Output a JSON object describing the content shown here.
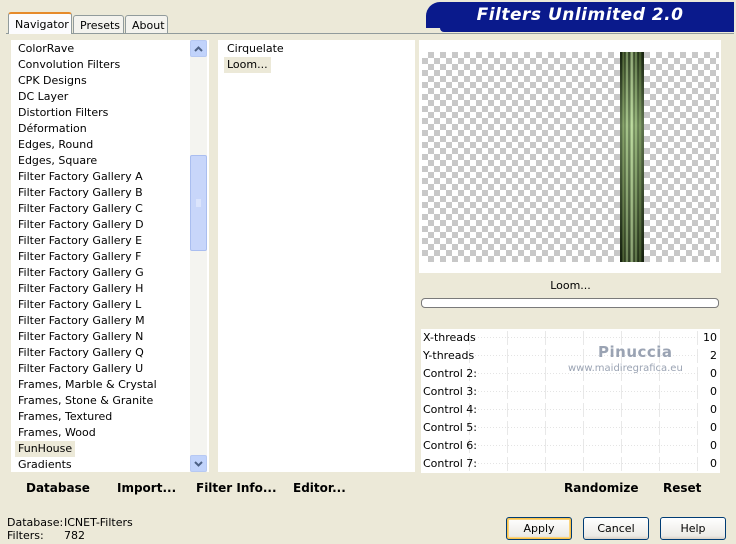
{
  "title": "Filters Unlimited 2.0",
  "tabs": [
    {
      "label": "Navigator",
      "active": true
    },
    {
      "label": "Presets",
      "active": false
    },
    {
      "label": "About",
      "active": false
    }
  ],
  "categories": {
    "items": [
      "ColorRave",
      "Convolution Filters",
      "CPK Designs",
      "DC Layer",
      "Distortion Filters",
      "Déformation",
      "Edges, Round",
      "Edges, Square",
      "Filter Factory Gallery A",
      "Filter Factory Gallery B",
      "Filter Factory Gallery C",
      "Filter Factory Gallery D",
      "Filter Factory Gallery E",
      "Filter Factory Gallery F",
      "Filter Factory Gallery G",
      "Filter Factory Gallery H",
      "Filter Factory Gallery L",
      "Filter Factory Gallery M",
      "Filter Factory Gallery N",
      "Filter Factory Gallery Q",
      "Filter Factory Gallery U",
      "Frames, Marble & Crystal",
      "Frames, Stone & Granite",
      "Frames, Textured",
      "Frames, Wood",
      "FunHouse",
      "Gradients"
    ],
    "selected": "FunHouse"
  },
  "filters": {
    "items": [
      "Cirquelate",
      "Loom..."
    ],
    "selected": "Loom..."
  },
  "preview_label": "Loom...",
  "controls": [
    {
      "label": "X-threads",
      "value": "10"
    },
    {
      "label": "Y-threads",
      "value": "2"
    },
    {
      "label": "Control 2:",
      "value": "0"
    },
    {
      "label": "Control 3:",
      "value": "0"
    },
    {
      "label": "Control 4:",
      "value": "0"
    },
    {
      "label": "Control 5:",
      "value": "0"
    },
    {
      "label": "Control 6:",
      "value": "0"
    },
    {
      "label": "Control 7:",
      "value": "0"
    }
  ],
  "watermark": {
    "name": "Pinuccia",
    "url": "www.maidiregrafica.eu"
  },
  "toolbar": {
    "database": "Database",
    "import": "Import...",
    "filter_info": "Filter Info...",
    "editor": "Editor...",
    "randomize": "Randomize",
    "reset": "Reset"
  },
  "status": {
    "database_label": "Database:",
    "database_value": "ICNET-Filters",
    "filters_label": "Filters:",
    "filters_value": "782"
  },
  "buttons": {
    "apply": "Apply",
    "cancel": "Cancel",
    "help": "Help"
  },
  "colors": {
    "banner": "#0a1a8c",
    "dialog": "#ece9d8",
    "selection": "#ece9d8"
  }
}
